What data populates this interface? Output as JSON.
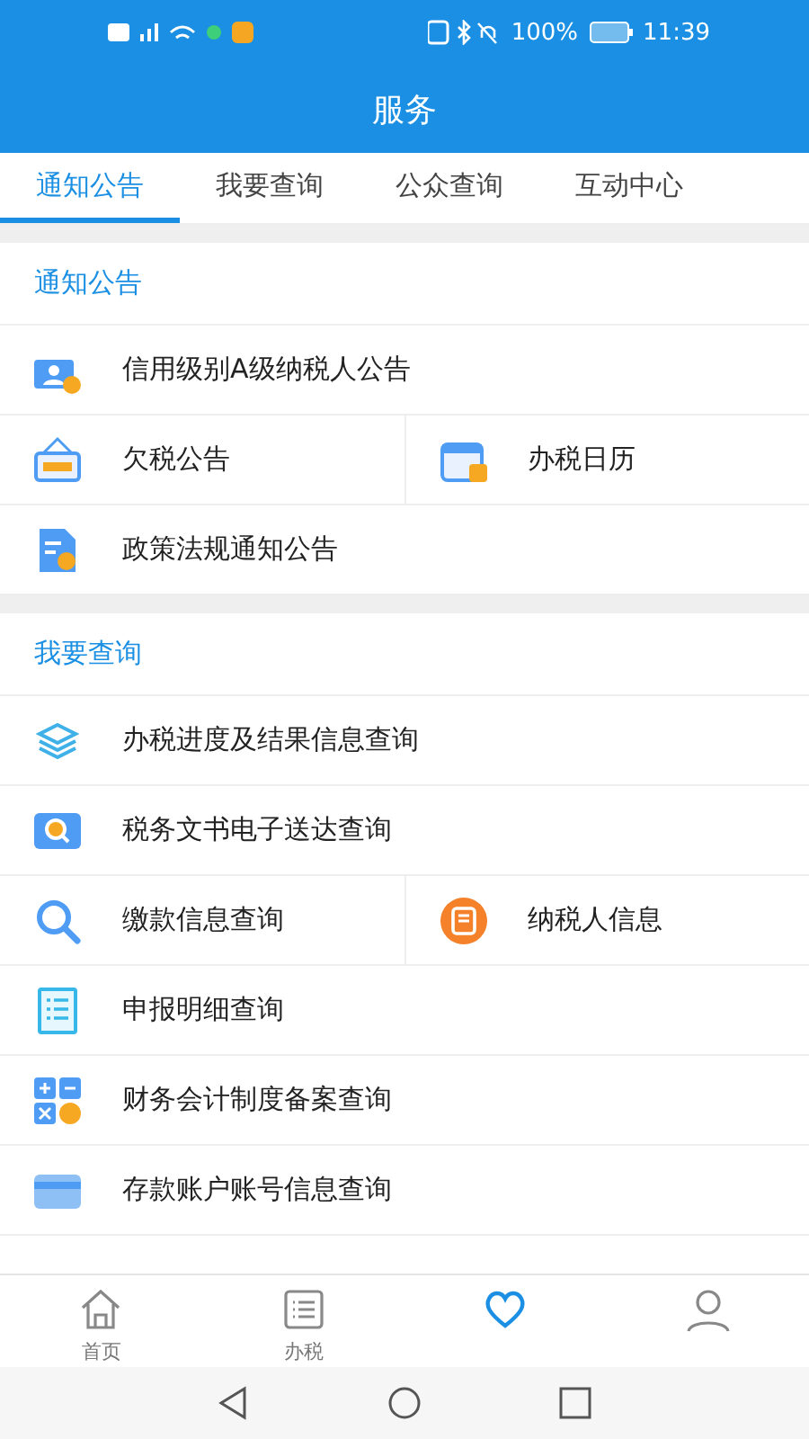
{
  "status_bar": {
    "battery": "100%",
    "time": "11:39"
  },
  "header": {
    "title": "服务"
  },
  "tabs": [
    {
      "label": "通知公告",
      "selected": true
    },
    {
      "label": "我要查询",
      "selected": false
    },
    {
      "label": "公众查询",
      "selected": false
    },
    {
      "label": "互动中心",
      "selected": false
    }
  ],
  "sections": [
    {
      "title": "通知公告",
      "rows": [
        [
          {
            "label": "信用级别A级纳税人公告",
            "kind": "badge"
          }
        ],
        [
          {
            "label": "欠税公告",
            "kind": "sign"
          },
          {
            "label": "办税日历",
            "kind": "calendar"
          }
        ],
        [
          {
            "label": "政策法规通知公告",
            "kind": "doc"
          }
        ]
      ]
    },
    {
      "title": "我要查询",
      "rows": [
        [
          {
            "label": "办税进度及结果信息查询",
            "kind": "layers"
          }
        ],
        [
          {
            "label": "税务文书电子送达查询",
            "kind": "book"
          }
        ],
        [
          {
            "label": "缴款信息查询",
            "kind": "search"
          },
          {
            "label": "纳税人信息",
            "kind": "orange"
          }
        ],
        [
          {
            "label": "申报明细查询",
            "kind": "list"
          }
        ],
        [
          {
            "label": "财务会计制度备案查询",
            "kind": "calc"
          }
        ],
        [
          {
            "label": "存款账户账号信息查询",
            "kind": "card"
          }
        ]
      ]
    }
  ],
  "bottom_nav": [
    {
      "kind": "home",
      "label": "首页",
      "selected": false
    },
    {
      "kind": "list",
      "label": "办税",
      "selected": false
    },
    {
      "kind": "heart",
      "selected": true
    },
    {
      "kind": "person",
      "selected": false
    }
  ]
}
